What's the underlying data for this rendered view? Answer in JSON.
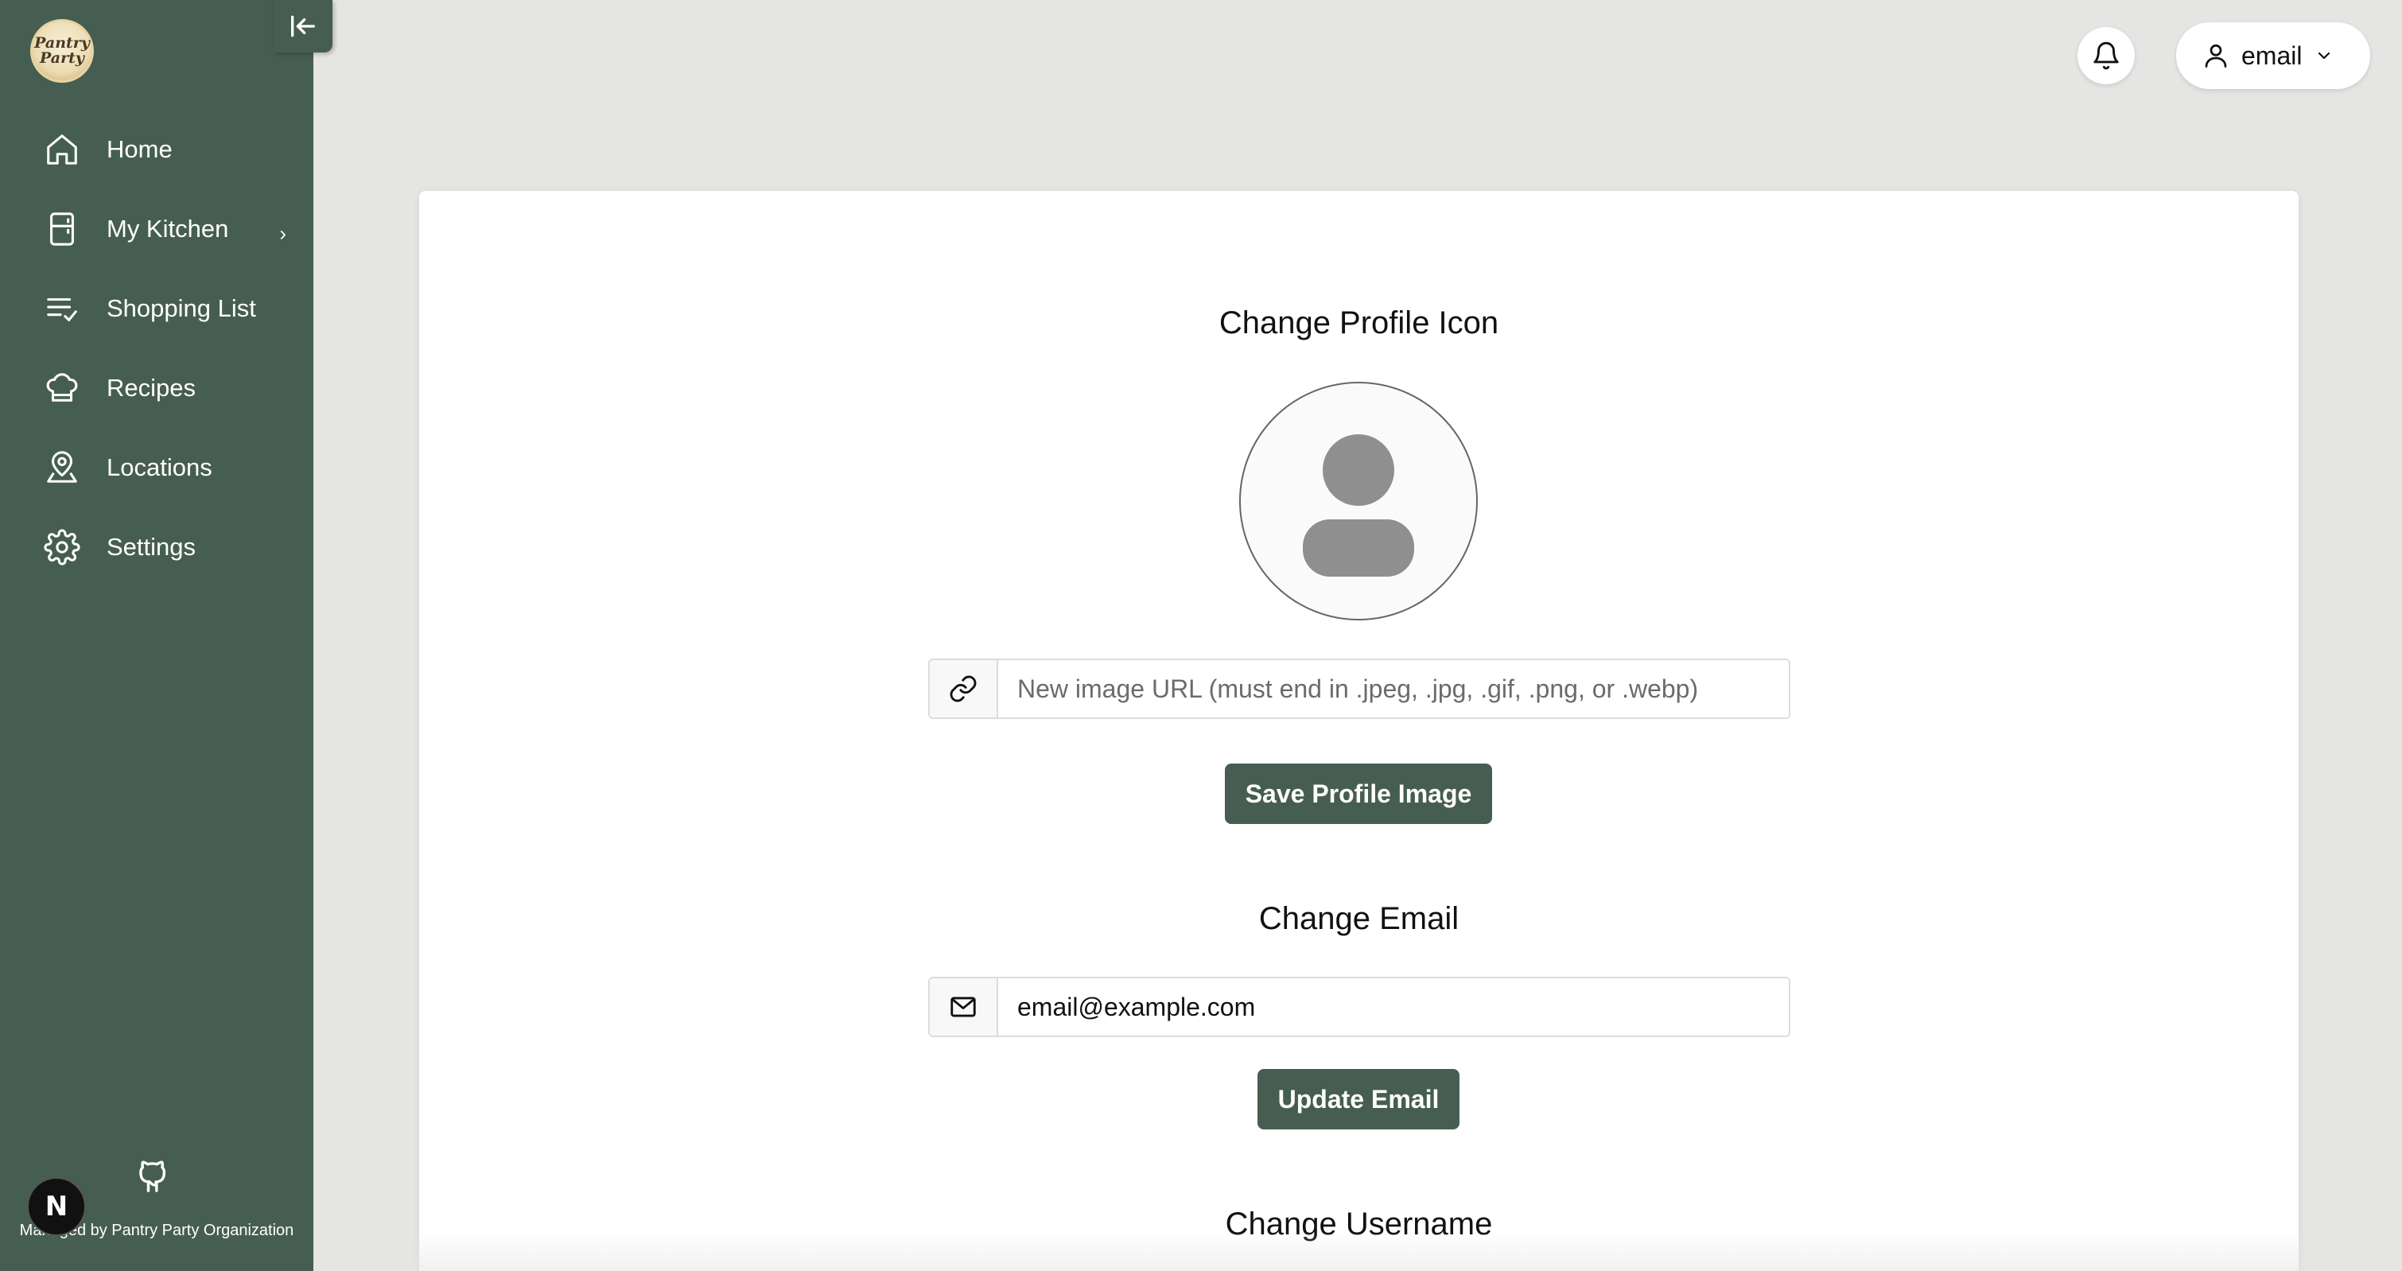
{
  "sidebar": {
    "logo_text_line1": "Pantry",
    "logo_text_line2": "Party",
    "collapse_icon": "collapse-left-icon",
    "items": [
      {
        "label": "Home",
        "icon": "home-icon"
      },
      {
        "label": "My Kitchen",
        "icon": "fridge-icon",
        "chevron": "›"
      },
      {
        "label": "Shopping List",
        "icon": "list-check-icon"
      },
      {
        "label": "Recipes",
        "icon": "chef-hat-icon"
      },
      {
        "label": "Locations",
        "icon": "location-user-icon"
      },
      {
        "label": "Settings",
        "icon": "gear-icon"
      }
    ],
    "github_icon": "github-icon",
    "next_badge": "N",
    "footer_text": "Managed by Pantry Party Organization"
  },
  "header": {
    "notifications_icon": "bell-icon",
    "user_menu_label": "email",
    "user_icon": "user-icon",
    "dropdown_icon": "chevron-down-icon"
  },
  "profile_icon_section": {
    "title": "Change Profile Icon",
    "url_placeholder": "New image URL (must end in .jpeg, .jpg, .gif, .png, or .webp)",
    "url_value": "",
    "save_button": "Save Profile Image"
  },
  "email_section": {
    "title": "Change Email",
    "email_value": "email@example.com",
    "update_button": "Update Email"
  },
  "username_section": {
    "title": "Change Username"
  },
  "colors": {
    "sidebar": "#465e51",
    "background": "#e5e5e3",
    "button": "#465e51"
  }
}
